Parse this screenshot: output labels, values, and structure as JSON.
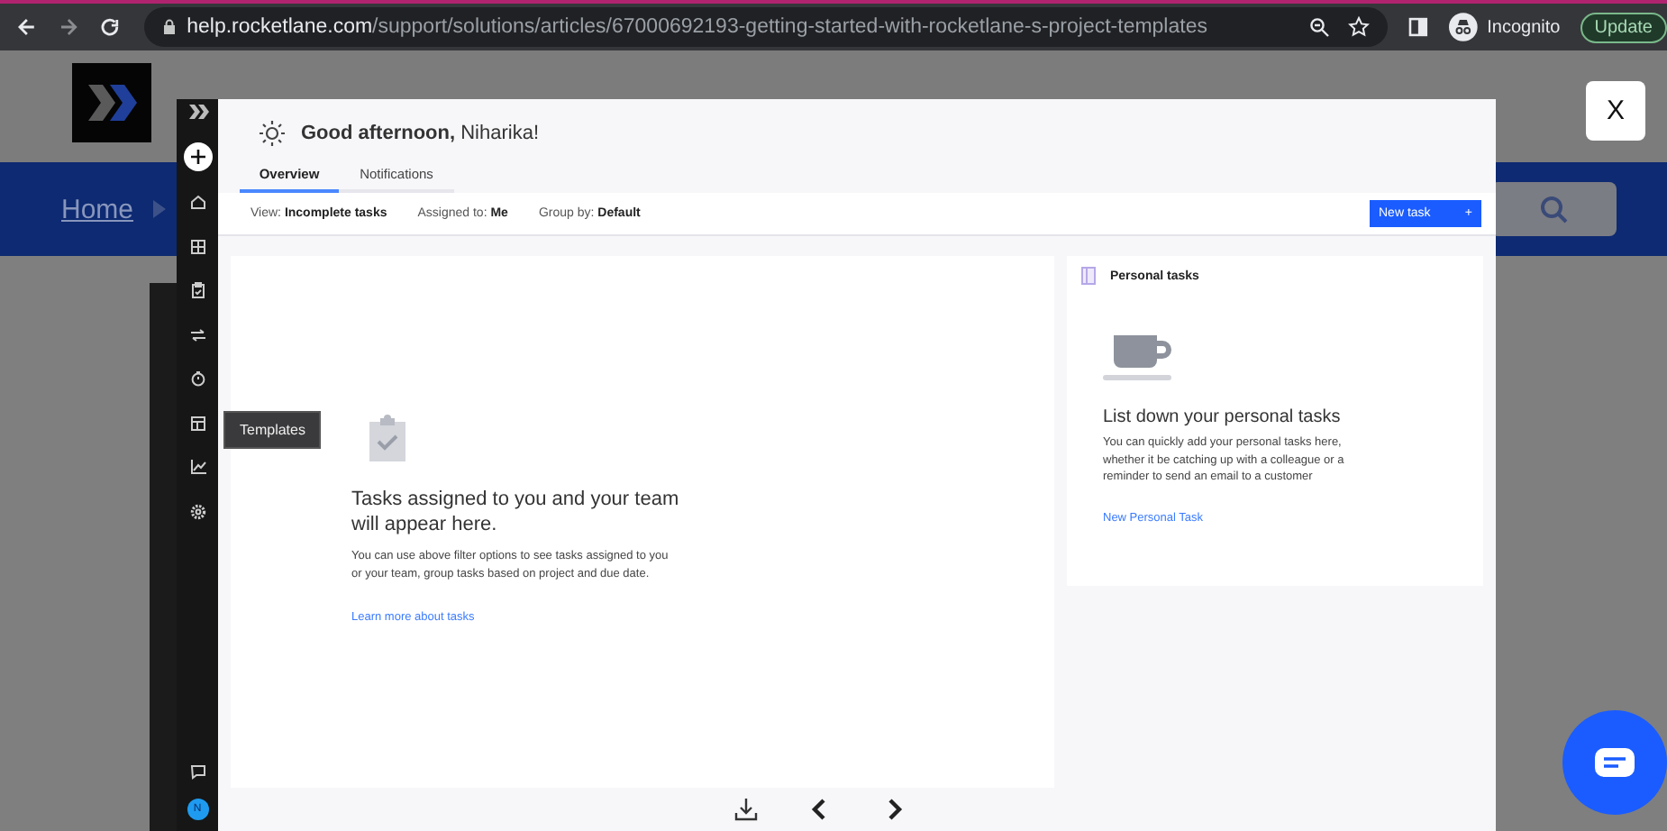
{
  "browser": {
    "url_host": "help.rocketlane.com",
    "url_path": "/support/solutions/articles/67000692193-getting-started-with-rocketlane-s-project-templates",
    "profile": "Incognito",
    "update_button": "Update"
  },
  "page": {
    "breadcrumb": "Home"
  },
  "lightbox": {
    "close": "X",
    "sidebar": {
      "tooltip": "Templates",
      "avatar": "N"
    },
    "greeting": "**Good afternoon,** Niharika!",
    "tabs": [
      {
        "label": "Overview",
        "selected": true
      },
      {
        "label": "Notifications",
        "selected": false
      }
    ],
    "filters": [
      "View: **Incomplete tasks**",
      "Assigned to: **Me**",
      "Group by: **Default**"
    ],
    "new_task": {
      "label": "New task",
      "icon": "+"
    },
    "empty_state": {
      "title": "Tasks assigned to you and your team will appear here.",
      "body": "You can use above filter options to see tasks assigned to you or your team, group tasks based on project and due date.",
      "link": "Learn more about tasks"
    },
    "personal": {
      "heading": "Personal tasks",
      "title": "List down your personal tasks",
      "body": "You can quickly add your personal tasks here, whether it be catching up with a colleague or a reminder to send an email to a customer",
      "link": "New Personal Task"
    }
  }
}
